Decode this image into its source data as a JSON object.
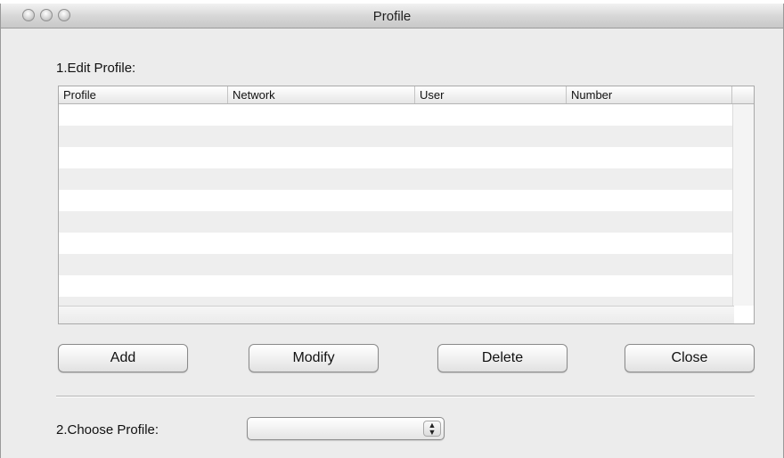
{
  "window": {
    "title": "Profile"
  },
  "edit_section": {
    "label": "1.Edit Profile:"
  },
  "table": {
    "columns": [
      "Profile",
      "Network",
      "User",
      "Number"
    ],
    "rows": []
  },
  "buttons": {
    "add": "Add",
    "modify": "Modify",
    "delete": "Delete",
    "close": "Close"
  },
  "choose_section": {
    "label": "2.Choose Profile:",
    "selected": ""
  },
  "icons": {
    "select_arrows": "up-down-chevron-icon"
  }
}
